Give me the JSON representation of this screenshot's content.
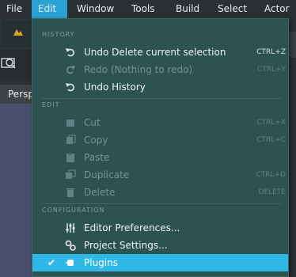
{
  "menubar": {
    "items": [
      {
        "label": "File"
      },
      {
        "label": "Edit"
      },
      {
        "label": "Window"
      },
      {
        "label": "Tools"
      },
      {
        "label": "Build"
      },
      {
        "label": "Select"
      },
      {
        "label": "Actor"
      }
    ],
    "active": "Edit"
  },
  "viewport": {
    "label": "Persp"
  },
  "edit_menu": {
    "sections": {
      "history": "HISTORY",
      "edit": "EDIT",
      "configuration": "CONFIGURATION"
    },
    "items": {
      "undo": {
        "label": "Undo Delete current selection",
        "shortcut": "CTRL+Z",
        "enabled": true
      },
      "redo": {
        "label": "Redo (Nothing to redo)",
        "shortcut": "CTRL+Y",
        "enabled": false
      },
      "undo_history": {
        "label": "Undo History",
        "enabled": true
      },
      "cut": {
        "label": "Cut",
        "shortcut": "CTRL+X",
        "enabled": false
      },
      "copy": {
        "label": "Copy",
        "shortcut": "CTRL+C",
        "enabled": false
      },
      "paste": {
        "label": "Paste",
        "shortcut": "CTRL+V",
        "enabled": false
      },
      "duplicate": {
        "label": "Duplicate",
        "shortcut": "CTRL+D",
        "enabled": false
      },
      "delete": {
        "label": "Delete",
        "shortcut": "DELETE",
        "enabled": false
      },
      "editor_preferences": {
        "label": "Editor Preferences...",
        "enabled": true
      },
      "project_settings": {
        "label": "Project Settings...",
        "enabled": true
      },
      "plugins": {
        "label": "Plugins",
        "enabled": true,
        "checked": true,
        "highlighted": true
      }
    }
  },
  "colors": {
    "menubar_bg": "#2b3133",
    "menu_active": "#29a3d6",
    "dropdown_bg": "#2d5252",
    "highlight": "#2fb7e6",
    "viewport": "#4a4f6f"
  }
}
